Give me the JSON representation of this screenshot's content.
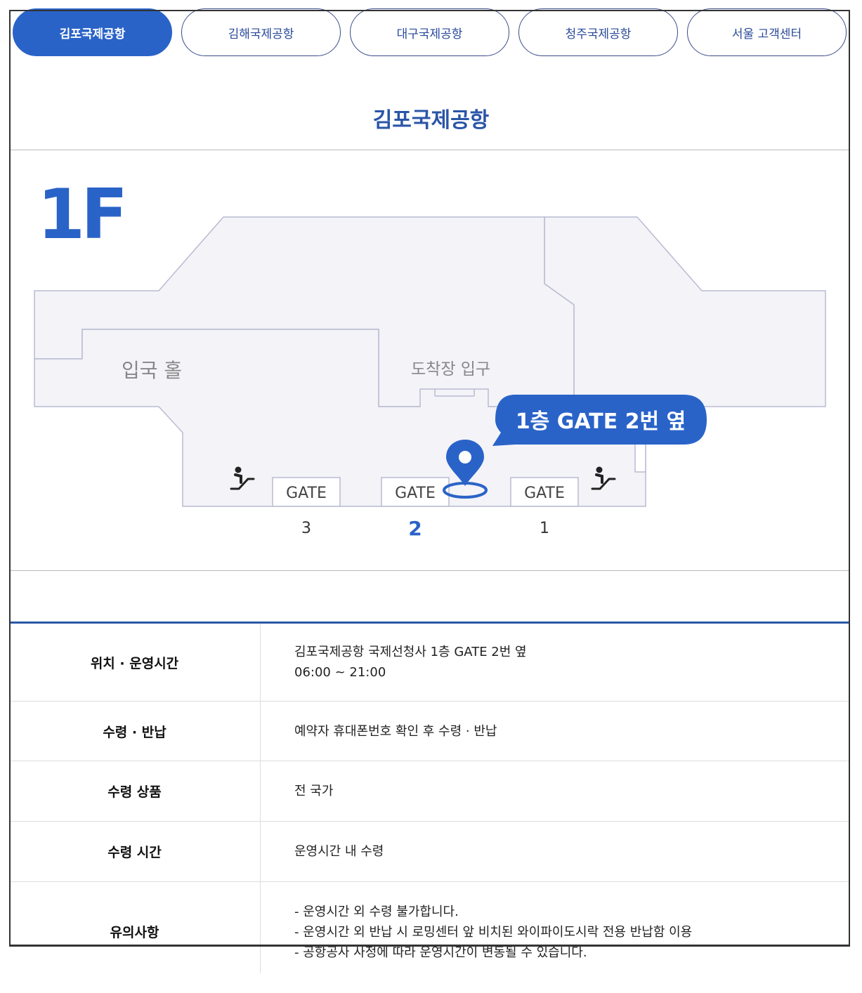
{
  "tabs": [
    {
      "label": "김포국제공항",
      "active": true
    },
    {
      "label": "김해국제공항",
      "active": false
    },
    {
      "label": "대구국제공항",
      "active": false
    },
    {
      "label": "청주국제공항",
      "active": false
    },
    {
      "label": "서울 고객센터",
      "active": false
    }
  ],
  "page_title": "김포국제공항",
  "map": {
    "floor": "1F",
    "arrival_hall": "입국 홀",
    "arrival_entrance": "도착장 입구",
    "callout": "1층 GATE 2번 옆",
    "gate_word": "GATE",
    "gates": [
      "3",
      "2",
      "1"
    ],
    "accent_color": "#2a63c8"
  },
  "info": [
    {
      "label": "위치 · 운영시간",
      "lines": [
        "김포국제공항 국제선청사 1층 GATE 2번 옆",
        "06:00 ~ 21:00"
      ]
    },
    {
      "label": "수령 · 반납",
      "lines": [
        "예약자 휴대폰번호 확인 후 수령 · 반납"
      ]
    },
    {
      "label": "수령 상품",
      "lines": [
        "전 국가"
      ]
    },
    {
      "label": "수령 시간",
      "lines": [
        "운영시간 내 수령"
      ]
    },
    {
      "label": "유의사항",
      "lines": [
        "- 운영시간 외 수령 불가합니다.",
        "- 운영시간 외 반납 시 로밍센터 앞 비치된 와이파이도시락 전용 반납함 이용",
        "- 공항공사 사정에 따라 운영시간이 변동될 수 있습니다."
      ]
    }
  ]
}
